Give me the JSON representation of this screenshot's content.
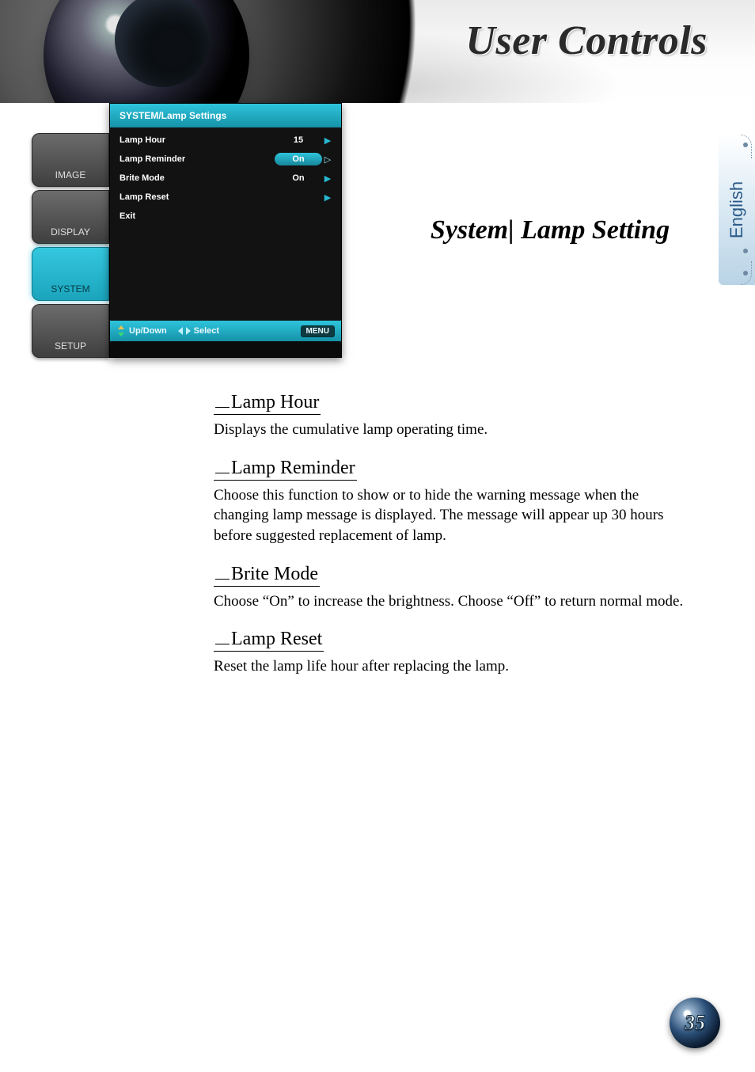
{
  "header": {
    "title": "User Controls"
  },
  "language_tab": "English",
  "osd": {
    "title": "SYSTEM/Lamp Settings",
    "side_tabs": [
      {
        "id": "image",
        "label": "IMAGE",
        "active": false
      },
      {
        "id": "display",
        "label": "DISPLAY",
        "active": false
      },
      {
        "id": "system",
        "label": "SYSTEM",
        "active": true
      },
      {
        "id": "setup",
        "label": "SETUP",
        "active": false
      }
    ],
    "rows": [
      {
        "label": "Lamp Hour",
        "value": "15",
        "selected": false
      },
      {
        "label": "Lamp Reminder",
        "value": "On",
        "selected": true
      },
      {
        "label": "Brite Mode",
        "value": "On",
        "selected": false
      },
      {
        "label": "Lamp Reset",
        "value": "",
        "selected": false
      },
      {
        "label": "Exit",
        "value": "",
        "selected": false,
        "no_arrow": true
      }
    ],
    "footer": {
      "updown": "Up/Down",
      "select": "Select",
      "menu": "MENU"
    }
  },
  "section_title": "System| Lamp Setting",
  "body": {
    "items": [
      {
        "heading": "Lamp Hour",
        "text": "Displays the cumulative lamp operating time."
      },
      {
        "heading": "Lamp Reminder",
        "text": "Choose this function to show or to hide the warning message when the changing lamp message is displayed. The message will appear up 30 hours before suggested replacement of lamp."
      },
      {
        "heading": "Brite Mode",
        "text": "Choose “On” to increase the brightness. Choose “Off” to return normal mode."
      },
      {
        "heading": "Lamp Reset",
        "text": "Reset the lamp life hour after replacing the lamp."
      }
    ]
  },
  "page_number": "35"
}
